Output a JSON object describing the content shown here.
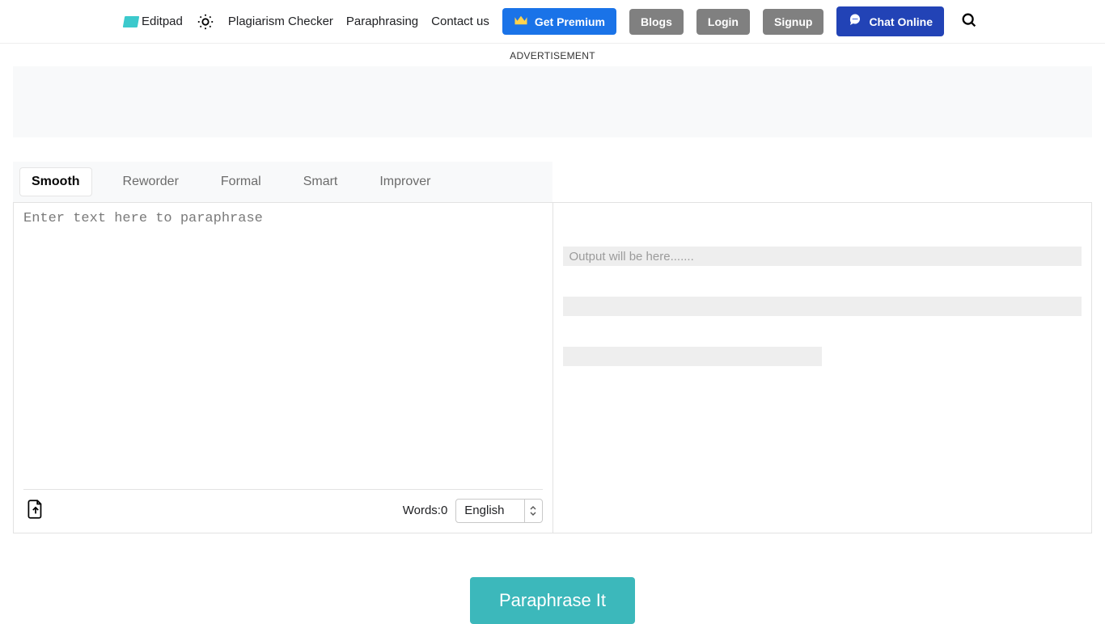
{
  "header": {
    "logo_text": "Editpad",
    "nav": {
      "plagiarism": "Plagiarism Checker",
      "paraphrasing": "Paraphrasing",
      "contact": "Contact us"
    },
    "premium": "Get Premium",
    "blogs": "Blogs",
    "login": "Login",
    "signup": "Signup",
    "chat": "Chat Online"
  },
  "ad_label": "ADVERTISEMENT",
  "modes": [
    "Smooth",
    "Reworder",
    "Formal",
    "Smart",
    "Improver"
  ],
  "input_placeholder": "Enter text here to paraphrase",
  "words_label": "Words:",
  "words_count": "0",
  "language": "English",
  "output_placeholder": "Output will be here.......",
  "paraphrase_button": "Paraphrase It"
}
